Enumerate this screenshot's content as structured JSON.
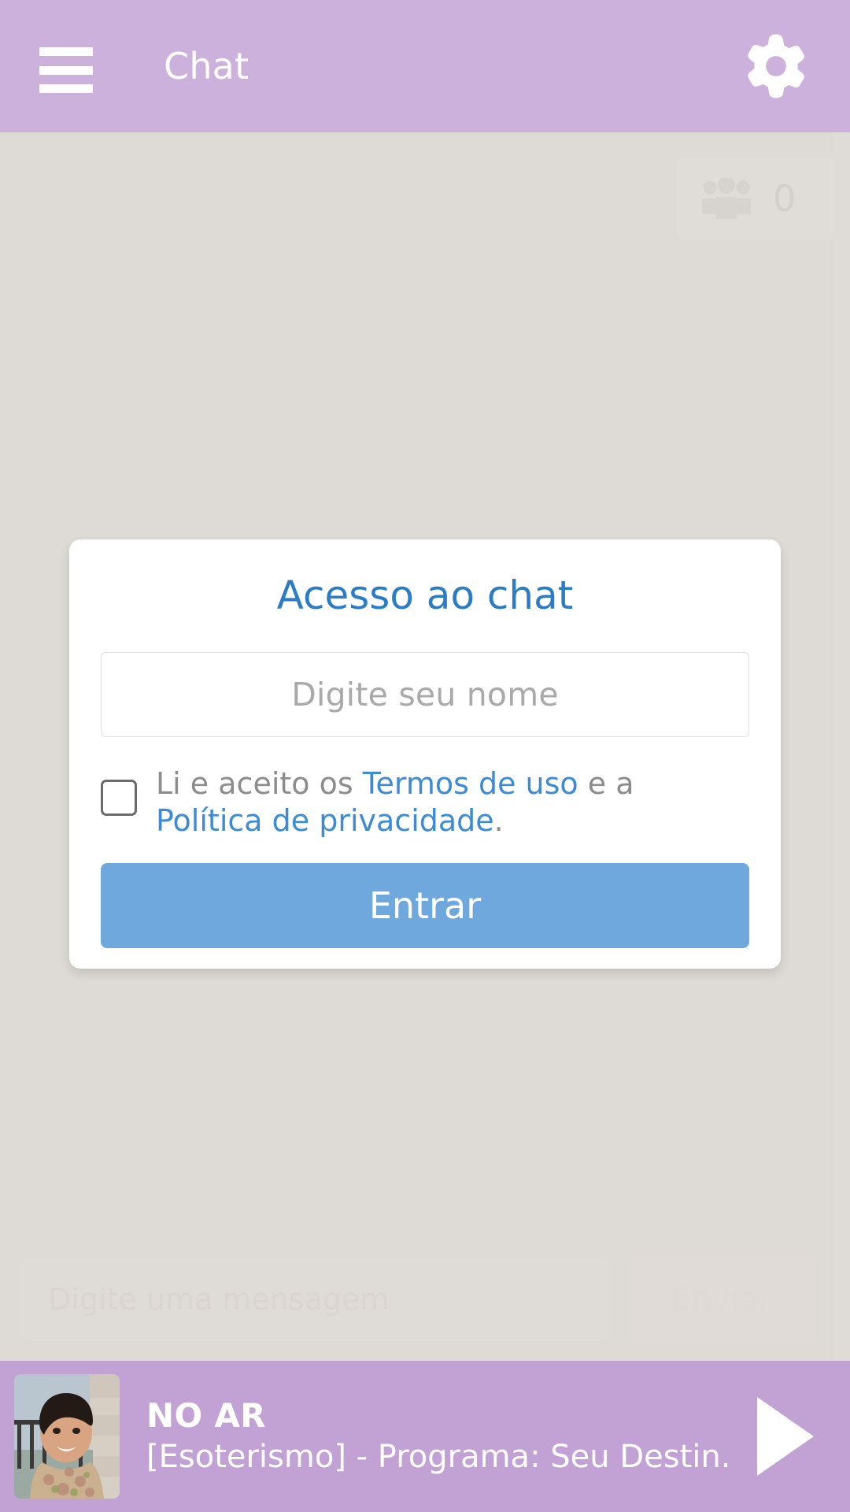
{
  "header": {
    "title": "Chat",
    "menu_icon": "hamburger-menu-icon",
    "settings_icon": "gear-icon"
  },
  "chat": {
    "members": {
      "icon": "users-group-icon",
      "count": "0"
    },
    "compose": {
      "placeholder": "Digite uma mensagem",
      "send_label": "Enviar"
    }
  },
  "modal": {
    "title": "Acesso ao chat",
    "name_input": {
      "value": "",
      "placeholder": "Digite seu nome"
    },
    "terms": {
      "prefix": "Li e aceito os ",
      "terms_link": "Termos de uso",
      "middle": " e a ",
      "privacy_link": "Política de privacidade",
      "suffix": ".",
      "checked": false
    },
    "submit_label": "Entrar"
  },
  "player": {
    "live_label": "NO AR",
    "program": "[Esoterismo] - Programa: Seu Destin..",
    "play_icon": "play-icon",
    "thumbnail_alt": "smiling-woman-photo"
  },
  "colors": {
    "header_purple": "#ccb1dc",
    "page_background": "#dedad5",
    "modal_title_blue": "#2b7cc4",
    "link_blue": "#3d8bd4",
    "button_blue": "#6fa8dc",
    "player_purple": "#c2a2d5"
  }
}
